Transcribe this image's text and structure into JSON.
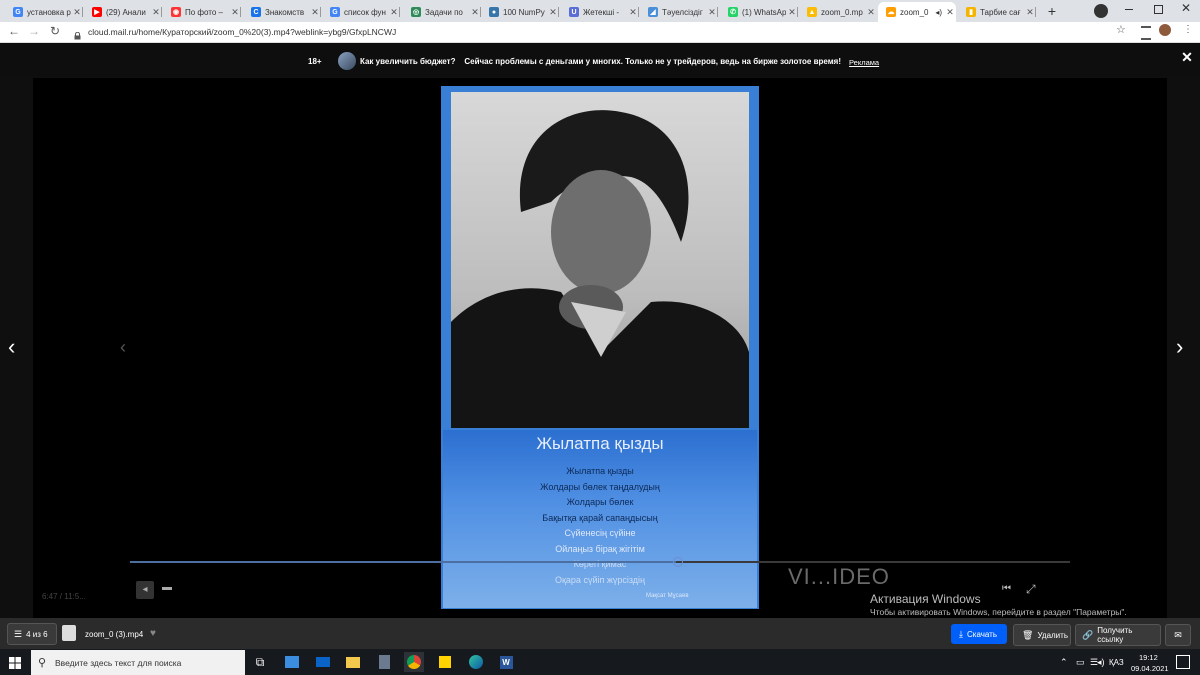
{
  "browser": {
    "tabs": [
      {
        "label": "установка р",
        "favicon": "google",
        "color": "#4285f4",
        "glyph": "G"
      },
      {
        "label": "(29) Анали",
        "favicon": "youtube",
        "color": "#ff0000",
        "glyph": "▶"
      },
      {
        "label": "По фото –",
        "favicon": "yandex-images",
        "color": "#f33",
        "glyph": "◉"
      },
      {
        "label": "Знакомств",
        "favicon": "c-icon",
        "color": "#1a73e8",
        "glyph": "C"
      },
      {
        "label": "список фун",
        "favicon": "google",
        "color": "#4285f4",
        "glyph": "G"
      },
      {
        "label": "Задачи по",
        "favicon": "site-icon",
        "color": "#2e8b57",
        "glyph": "◎"
      },
      {
        "label": "100 NumPy",
        "favicon": "python",
        "color": "#3776ab",
        "glyph": "●"
      },
      {
        "label": "Жетекші -",
        "favicon": "u-icon",
        "color": "#5b6dd6",
        "glyph": "U"
      },
      {
        "label": "Тәуелсіздіг",
        "favicon": "site-icon",
        "color": "#4a90d9",
        "glyph": "◢"
      },
      {
        "label": "(1) WhatsAp",
        "favicon": "whatsapp",
        "color": "#25d366",
        "glyph": "✆"
      },
      {
        "label": "zoom_0.mp",
        "favicon": "google-drive",
        "color": "#fbbc04",
        "glyph": "▲"
      },
      {
        "label": "zoom_0",
        "favicon": "mail-cloud",
        "color": "#ff9e00",
        "glyph": "☁"
      },
      {
        "label": "Тарбие сағ",
        "favicon": "site-icon",
        "color": "#f4b400",
        "glyph": "▮"
      }
    ],
    "url": "cloud.mail.ru/home/Кураторский/zoom_0%20(3).mp4?weblink=ybg9/GfxpLNCWJ"
  },
  "ad": {
    "age": "18+",
    "text": "Как увеличить бюджет?    Сейчас проблемы с деньгами у многих. Только не у трейдеров, ведь на бирже золотое время!",
    "link": "Реклама"
  },
  "video": {
    "poster_title": "Жылатпа қызды",
    "poster_lines": [
      "Жылатпа қызды",
      "Жолдары бөлек таңдалудың",
      "Жолдары бөлек",
      "Бақытқа қарай сапаңдысың",
      "Сүйенесің сүйіне",
      "Ойлаңыз бірақ жігітім",
      "Көрегі қимас",
      "Оқара сүйіп жүрсіздің"
    ],
    "poster_author": "Мақсат Мұсаев",
    "watermark": "VI...IDEO",
    "ghost_time": "6:47 / 11:5..."
  },
  "windows_activation": {
    "title": "Активация Windows",
    "subtitle": "Чтобы активировать Windows, перейдите в раздел \"Параметры\"."
  },
  "file_bar": {
    "counter": "4 из 6",
    "filename": "zoom_0 (3).mp4",
    "download": "Скачать",
    "delete": "Удалить",
    "share": "Получить ссылку"
  },
  "taskbar": {
    "search_placeholder": "Введите здесь текст для поиска",
    "lang": "ҚАЗ",
    "time": "19:12",
    "date": "09.04.2021"
  },
  "colors": {
    "accent_blue": "#1a73e8",
    "poster_blue": "#3a7fd6",
    "mail_download": "#005ff9"
  }
}
